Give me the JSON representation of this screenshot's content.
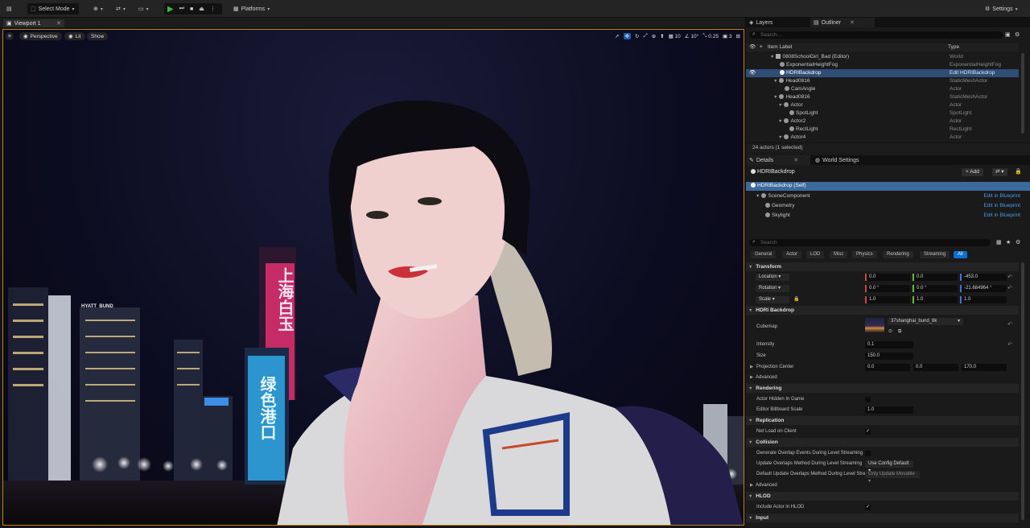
{
  "toolbar": {
    "select_mode": "Select Mode",
    "platforms": "Platforms",
    "settings": "Settings"
  },
  "viewport": {
    "tab_label": "Viewport 1",
    "perspective": "Perspective",
    "lit": "Lit",
    "show": "Show",
    "grid_snap": "10",
    "rotation_snap": "10°",
    "scale_snap": "0.25",
    "camera_speed": "3"
  },
  "scene": {
    "neon_red": "上海白玉",
    "neon_blue": "绿色港口",
    "sign_hyatt": "HYATT",
    "sign_bund": "BUND"
  },
  "outliner": {
    "layers_tab": "Layers",
    "outliner_tab": "Outliner",
    "search_placeholder": "Search...",
    "col_label": "Item Label",
    "col_type": "Type",
    "rows": [
      {
        "label": "0808SchoolGirl_Bad (Editor)",
        "type": "World"
      },
      {
        "label": "ExponentialHeightFog",
        "type": "ExponentialHeightFog"
      },
      {
        "label": "HDRIBackdrop",
        "type": "Edit HDRIBackdrop"
      },
      {
        "label": "Head0816",
        "type": "StaticMeshActor"
      },
      {
        "label": "CamAngle",
        "type": "Actor"
      },
      {
        "label": "Head0816",
        "type": "StaticMeshActor"
      },
      {
        "label": "Actor",
        "type": "Actor"
      },
      {
        "label": "SpotLight",
        "type": "SpotLight"
      },
      {
        "label": "Actor2",
        "type": "Actor"
      },
      {
        "label": "RectLight",
        "type": "RectLight"
      },
      {
        "label": "Actor4",
        "type": "Actor"
      }
    ],
    "status": "24 actors (1 selected)"
  },
  "details": {
    "details_tab": "Details",
    "world_settings_tab": "World Settings",
    "actor_name": "HDRIBackdrop",
    "add_label": "+ Add",
    "components": [
      {
        "label": "HDRIBackdrop (Self)",
        "link": ""
      },
      {
        "label": "SceneComponent",
        "link": "Edit in Blueprint"
      },
      {
        "label": "Geometry",
        "link": "Edit in Blueprint"
      },
      {
        "label": "Skylight",
        "link": "Edit in Blueprint"
      }
    ],
    "search_placeholder": "Search",
    "filters": [
      "General",
      "Actor",
      "LOD",
      "Misc",
      "Physics",
      "Rendering",
      "Streaming",
      "All"
    ],
    "transform": {
      "title": "Transform",
      "location_label": "Location",
      "rotation_label": "Rotation",
      "scale_label": "Scale",
      "location": [
        "0.0",
        "0.0",
        "-453.0"
      ],
      "rotation": [
        "0.0 °",
        "0.0 °",
        "-21.684964 °"
      ],
      "scale": [
        "1.0",
        "1.0",
        "1.0"
      ]
    },
    "hdri": {
      "title": "HDRI Backdrop",
      "cubemap_label": "Cubemap",
      "cubemap_value": "37shanghai_bund_8k",
      "intensity_label": "Intensity",
      "intensity": "0.1",
      "size_label": "Size",
      "size": "150.0",
      "projection_label": "Projection Center",
      "projection": [
        "0.0",
        "0.0",
        "170.0"
      ],
      "advanced": "Advanced"
    },
    "rendering": {
      "title": "Rendering",
      "hidden_label": "Actor Hidden In Game",
      "billboard_label": "Editor Billboard Scale",
      "billboard": "1.0"
    },
    "replication": {
      "title": "Replication",
      "net_load_label": "Net Load on Client"
    },
    "collision": {
      "title": "Collision",
      "gen_overlap_label": "Generate Overlap Events During Level Streaming",
      "update_overlap_label": "Update Overlaps Method During Level Streaming",
      "update_overlap_value": "Use Config Default",
      "default_update_label": "Default Update Overlaps Method During Level Strea...",
      "default_update_value": "Only Update Movable",
      "advanced": "Advanced"
    },
    "hlod": {
      "title": "HLOD",
      "include_label": "Include Actor in HLOD"
    },
    "input": {
      "title": "Input"
    }
  },
  "colors": {
    "accent": "#0b6fd8",
    "selection": "#2f4e75",
    "viewport_border": "#c08020",
    "play_green": "#3bbd3b"
  }
}
